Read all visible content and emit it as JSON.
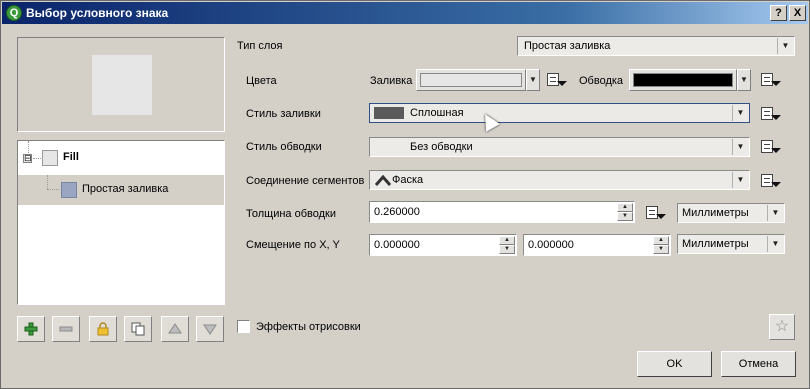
{
  "window": {
    "title": "Выбор условного знака",
    "help_btn": "?",
    "close_btn": "X",
    "icon_letter": "Q"
  },
  "tree": {
    "root_label": "Fill",
    "root_expander": "⊟",
    "child_label": "Простая заливка"
  },
  "layer_buttons": [
    "add",
    "remove",
    "lock",
    "duplicate",
    "move-up",
    "move-down"
  ],
  "form": {
    "layer_type_label": "Тип слоя",
    "layer_type_value": "Простая заливка",
    "colors_label": "Цвета",
    "fill_label": "Заливка",
    "fill_color": "#e6e6e6",
    "stroke_label": "Обводка",
    "stroke_color": "#000000",
    "fill_style_label": "Стиль заливки",
    "fill_style_value": "Сплошная",
    "stroke_style_label": "Стиль обводки",
    "stroke_style_value": "Без обводки",
    "join_label": "Соединение сегментов",
    "join_value": "Фаска",
    "stroke_width_label": "Толщина обводки",
    "stroke_width_value": "0.260000",
    "stroke_width_unit": "Миллиметры",
    "offset_label": "Смещение по X, Y",
    "offset_x": "0.000000",
    "offset_y": "0.000000",
    "offset_unit": "Миллиметры"
  },
  "effects_label": "Эффекты отрисовки",
  "buttons": {
    "ok": "OK",
    "cancel": "Отмена"
  },
  "colors": {
    "fill_style_swatch": "#5a5a5a",
    "tree_fill_swatch": "#e6e6e6",
    "tree_child_swatch": "#9aa5c2"
  }
}
